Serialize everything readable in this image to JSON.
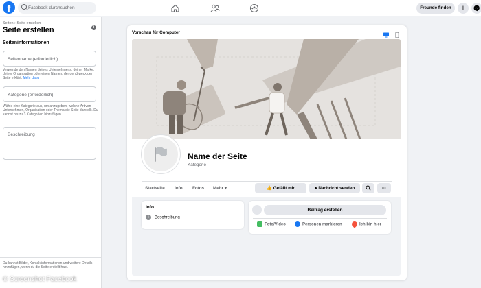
{
  "topbar": {
    "logo": "f",
    "search_placeholder": "Facebook durchsuchen",
    "nav_icons": [
      "home-icon",
      "friends-icon",
      "groups-icon"
    ],
    "friends_button": "Freunde finden",
    "plus_icon": "+",
    "messenger_icon": "messenger-icon"
  },
  "sidebar": {
    "breadcrumb": "Seiten › Seite erstellen",
    "title": "Seite erstellen",
    "section_title": "Seiteninformationen",
    "page_name_placeholder": "Seitenname (erforderlich)",
    "page_name_help": "Verwende den Namen deines Unternehmens, deiner Marke, deiner Organisation oder einen Namen, der den Zweck der Seite erklärt.",
    "page_name_help_link": "Mehr dazu",
    "category_placeholder": "Kategorie (erforderlich)",
    "category_help": "Wähle eine Kategorie aus, um anzugeben, welche Art von Unternehmen, Organisation oder Thema die Seite darstellt. Du kannst bis zu 3 Kategorien hinzufügen.",
    "description_placeholder": "Beschreibung",
    "footer_text": "Du kannst Bilder, Kontaktinformationen und weitere Details hinzufügen, wenn du die Seite erstellt hast."
  },
  "preview": {
    "title": "Vorschau für Computer",
    "page_name": "Name der Seite",
    "category": "Kategorie",
    "tabs": [
      "Startseite",
      "Info",
      "Fotos",
      "Mehr ▾"
    ],
    "like_button": "Gefällt mir",
    "message_button": "Nachricht senden",
    "more_button": "···",
    "info_card_title": "Info",
    "info_description": "Beschreibung",
    "create_post": "Beitrag erstellen",
    "actions": [
      "Foto/Video",
      "Personen markieren",
      "Ich bin hier"
    ]
  },
  "watermark": "© Screenshot Facebook",
  "colors": {
    "brand": "#1877f2",
    "background": "#f0f2f5",
    "cover": "#e5e2df"
  }
}
